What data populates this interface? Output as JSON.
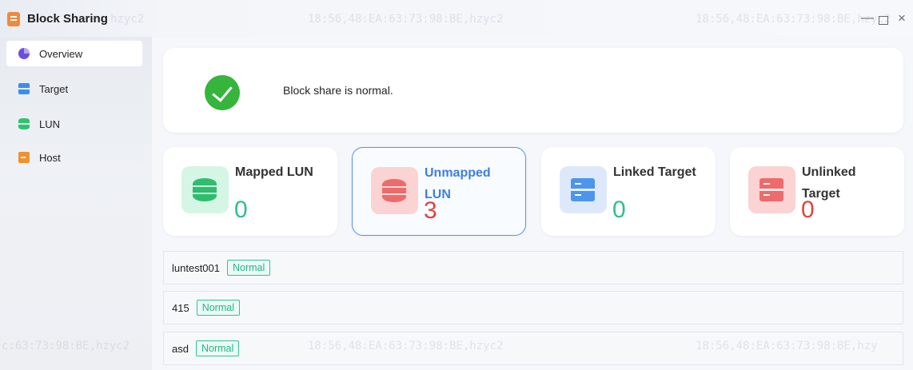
{
  "window": {
    "title": "Block Sharing",
    "minimize": "—",
    "close": "×"
  },
  "sidebar": {
    "items": [
      {
        "label": "Overview",
        "icon": "pie-chart-icon",
        "active": true
      },
      {
        "label": "Target",
        "icon": "server-icon"
      },
      {
        "label": "LUN",
        "icon": "database-icon"
      },
      {
        "label": "Host",
        "icon": "host-icon"
      }
    ]
  },
  "status": {
    "message": "Block share is normal.",
    "icon": "check-circle-icon",
    "color": "#35b53c"
  },
  "stats": [
    {
      "label": "Mapped LUN",
      "value": "0",
      "value_color": "#2fbf8a"
    },
    {
      "label": "Unmapped LUN",
      "value": "3",
      "value_color": "#e0443e",
      "label_color": "#3d7ee0",
      "selected": true
    },
    {
      "label": "Linked Target",
      "value": "0",
      "value_color": "#2fbf8a"
    },
    {
      "label": "Unlinked Target",
      "value": "0",
      "value_color": "#e0443e"
    }
  ],
  "lun_list": [
    {
      "name": "luntest001",
      "status": "Normal"
    },
    {
      "name": "415",
      "status": "Normal"
    },
    {
      "name": "asd",
      "status": "Normal"
    }
  ],
  "watermark": {
    "text": "18:56,48:EA:63:73:98:BE,hzyc2",
    "fragment_a": "hzyc2",
    "fragment_b": "c:63:73:98:BE,hzyc2",
    "fragment_c": "18:56,48:EA:63:73:98:BE,hzy"
  }
}
